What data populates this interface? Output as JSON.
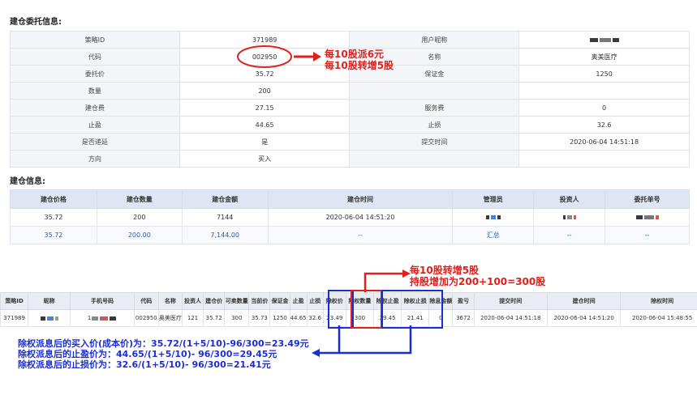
{
  "order_section": {
    "title": "建仓委托信息:",
    "rows": [
      {
        "k1": "策略ID",
        "v1": "371989",
        "k2": "用户昵称",
        "v2": ""
      },
      {
        "k1": "代码",
        "v1": "002950",
        "k2": "名称",
        "v2": "奥美医疗"
      },
      {
        "k1": "委托价",
        "v1": "35.72",
        "k2": "保证金",
        "v2": "1250"
      },
      {
        "k1": "数量",
        "v1": "200",
        "k2": "",
        "v2": ""
      },
      {
        "k1": "建仓费",
        "v1": "27.15",
        "k2": "服务费",
        "v2": "0"
      },
      {
        "k1": "止盈",
        "v1": "44.65",
        "k2": "止损",
        "v2": "32.6"
      },
      {
        "k1": "是否递延",
        "v1": "是",
        "k2": "提交时间",
        "v2": "2020-06-04 14:51:18"
      },
      {
        "k1": "方向",
        "v1": "买入",
        "k2": "",
        "v2": ""
      }
    ]
  },
  "annotation_top": {
    "line1": "每10股派6元",
    "line2": "每10股转增5股"
  },
  "position_section": {
    "title": "建仓信息:",
    "headers": [
      "建仓价格",
      "建仓数量",
      "建仓金额",
      "建仓时间",
      "管理员",
      "投资人",
      "委托单号"
    ],
    "row1": [
      "35.72",
      "200",
      "7144",
      "2020-06-04 14:51:20",
      "",
      "",
      ""
    ],
    "row2": [
      "35.72",
      "200.00",
      "7,144.00",
      "--",
      "汇总",
      "--",
      "--"
    ]
  },
  "annotation_middle": {
    "line1": "每10股转增5股",
    "line2": "持股增加为200+100=300股"
  },
  "bottom_table": {
    "headers": [
      "策略ID",
      "昵称",
      "手机号码",
      "代码",
      "名称",
      "投资人",
      "建仓价",
      "可卖数量",
      "当前价",
      "保证金",
      "止盈",
      "止损",
      "除权价",
      "除权数量",
      "除权止盈",
      "除权止损",
      "除息金额",
      "盈亏",
      "提交时间",
      "建仓时间",
      "除权时间"
    ],
    "row": [
      "371989",
      "",
      "1",
      "002950",
      "奥美医疗",
      "121",
      "35.72",
      "300",
      "35.73",
      "1250",
      "44.65",
      "32.6",
      "23.49",
      "300",
      "29.45",
      "21.41",
      "0",
      "3672",
      "2020-06-04 14:51:18",
      "2020-06-04 14:51:20",
      "2020-06-04 15:48:55"
    ]
  },
  "annotation_bottom": {
    "line1": "除权派息后的买入价(成本价)为：35.72/(1+5/10)-96/300=23.49元",
    "line2": "除权派息后的止盈价为：44.65/(1+5/10)- 96/300=29.45元",
    "line3": "除权派息后的止损价为：32.6/(1+5/10)- 96/300=21.41元"
  },
  "colors": {
    "annotation_red": "#e0201c",
    "annotation_blue": "#1b2dd6",
    "header_blue": "#dde6f2"
  }
}
